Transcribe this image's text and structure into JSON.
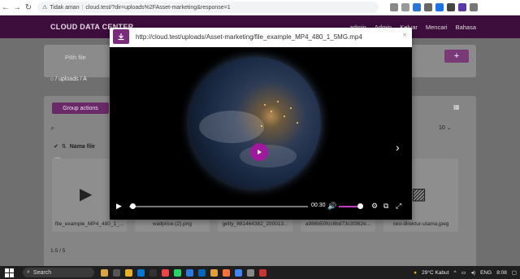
{
  "browser": {
    "security_label": "Tidak aman",
    "url": "cloud.test/?dir=uploads%2FAsset-marketing&response=1"
  },
  "app": {
    "brand": "CLOUD DATA CENTER",
    "header_items": [
      "admin",
      "Admin",
      "Keluar",
      "Mencari",
      "Bahasa"
    ],
    "file_input_placeholder": "Pilih file",
    "add_button": "+",
    "breadcrumb": [
      "uploads",
      "A"
    ],
    "group_actions_label": "Group actions",
    "per_page": "10",
    "sort_label": "Nama file",
    "files": [
      "file_example_MP4_480_1_...",
      "wallprice-(2).png",
      "getty_881464382_200013...",
      "a986b50fcc6bd73c3f362e...",
      "ceo-direktur-utama.jpeg"
    ],
    "pagination_text": "1-5 / 5"
  },
  "modal": {
    "url": "http://cloud.test/uploads/Asset-marketing/file_example_MP4_480_1_5MG.mp4",
    "close_icon": "×",
    "time": "00:30",
    "progress": 0.02,
    "volume": 0.85
  },
  "taskbar": {
    "search_label": "Search",
    "weather": "29°C  Kabut",
    "language": "ENG",
    "time": "8:08"
  },
  "colors": {
    "brand_purple": "#7b2b7b",
    "header_dark": "#3d0d3c",
    "play_purple": "#a0199d"
  }
}
